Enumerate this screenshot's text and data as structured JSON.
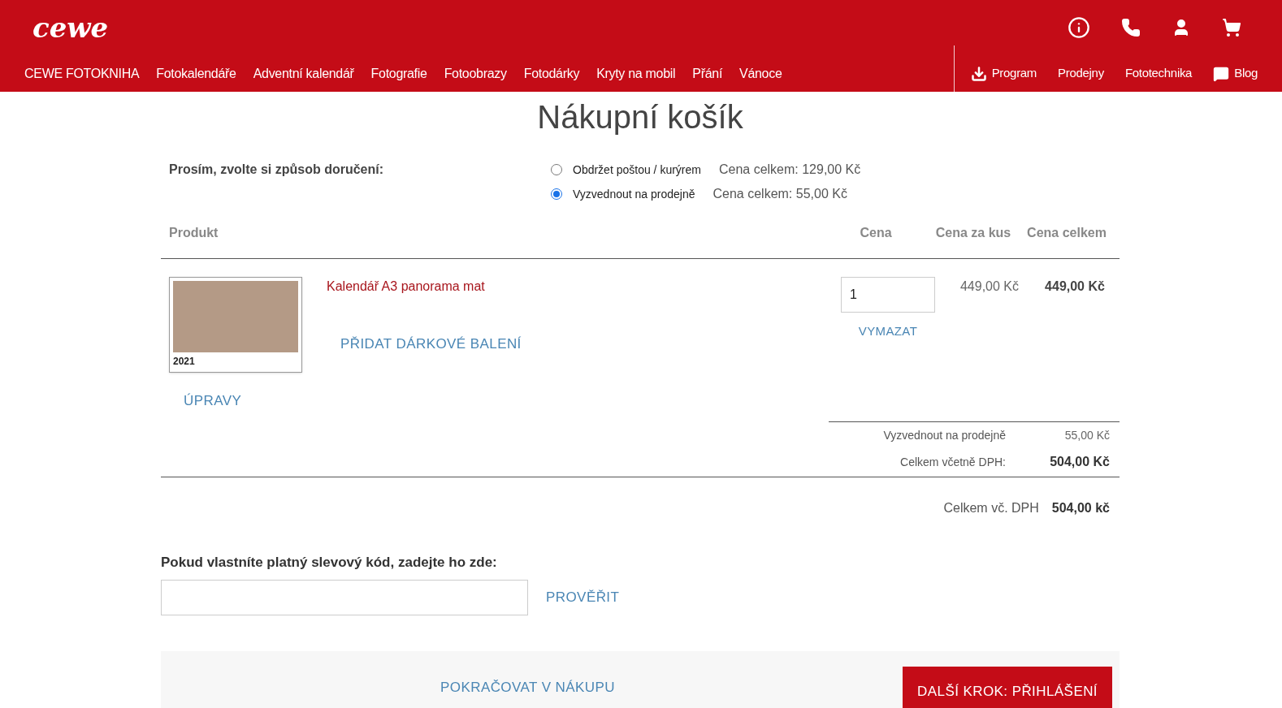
{
  "header": {
    "logo": "cewe",
    "nav": [
      {
        "label": "CEWE FOTOKNIHA"
      },
      {
        "label": "Fotokalendáře"
      },
      {
        "label": "Adventní kalendář"
      },
      {
        "label": "Fotografie"
      },
      {
        "label": "Fotoobrazy"
      },
      {
        "label": "Fotodárky"
      },
      {
        "label": "Kryty na mobil"
      },
      {
        "label": "Přání"
      },
      {
        "label": "Vánoce"
      }
    ],
    "service_links": [
      {
        "label": "Program",
        "kind": "download"
      },
      {
        "label": "Prodejny",
        "kind": "plain"
      },
      {
        "label": "Fototechnika",
        "kind": "plain"
      },
      {
        "label": "Blog",
        "kind": "chat"
      }
    ]
  },
  "title": "Nákupní košík",
  "delivery": {
    "label": "Prosím, zvolte si způsob doručení:",
    "options": [
      {
        "label": "Obdržet poštou / kurýrem",
        "price": "Cena celkem: 129,00 Kč",
        "selected": false
      },
      {
        "label": "Vyzvednout na prodejně",
        "price": "Cena celkem: 55,00 Kč",
        "selected": true
      }
    ]
  },
  "table": {
    "columns": [
      "Produkt",
      "Cena",
      "Cena za kus",
      "Cena celkem"
    ],
    "rows": [
      {
        "name": "Kalendář A3 panorama mat",
        "thumbnail_year": "2021",
        "edit": "ÚPRAVY",
        "gift_wrap": "PŘIDAT DÁRKOVÉ BALENÍ",
        "quantity": "1",
        "remove": "VYMAZAT",
        "unit_price": "449,00 Kč",
        "total": "449,00 Kč"
      }
    ],
    "summary": [
      {
        "label": "Vyzvednout na prodejně",
        "value": "55,00 Kč",
        "bold": false
      },
      {
        "label": "Celkem včetně DPH:",
        "value": "504,00 Kč",
        "bold": true
      }
    ]
  },
  "grand_total": {
    "label": "Celkem vč. DPH",
    "value": "504,00 kč"
  },
  "voucher": {
    "label": "Pokud vlastníte platný slevový kód, zadejte ho zde:",
    "button": "PROVĚŘIT"
  },
  "footer": {
    "continue": "POKRAČOVAT V NÁKUPU",
    "next": "DALŠÍ KROK: PŘIHLÁŠENÍ"
  }
}
